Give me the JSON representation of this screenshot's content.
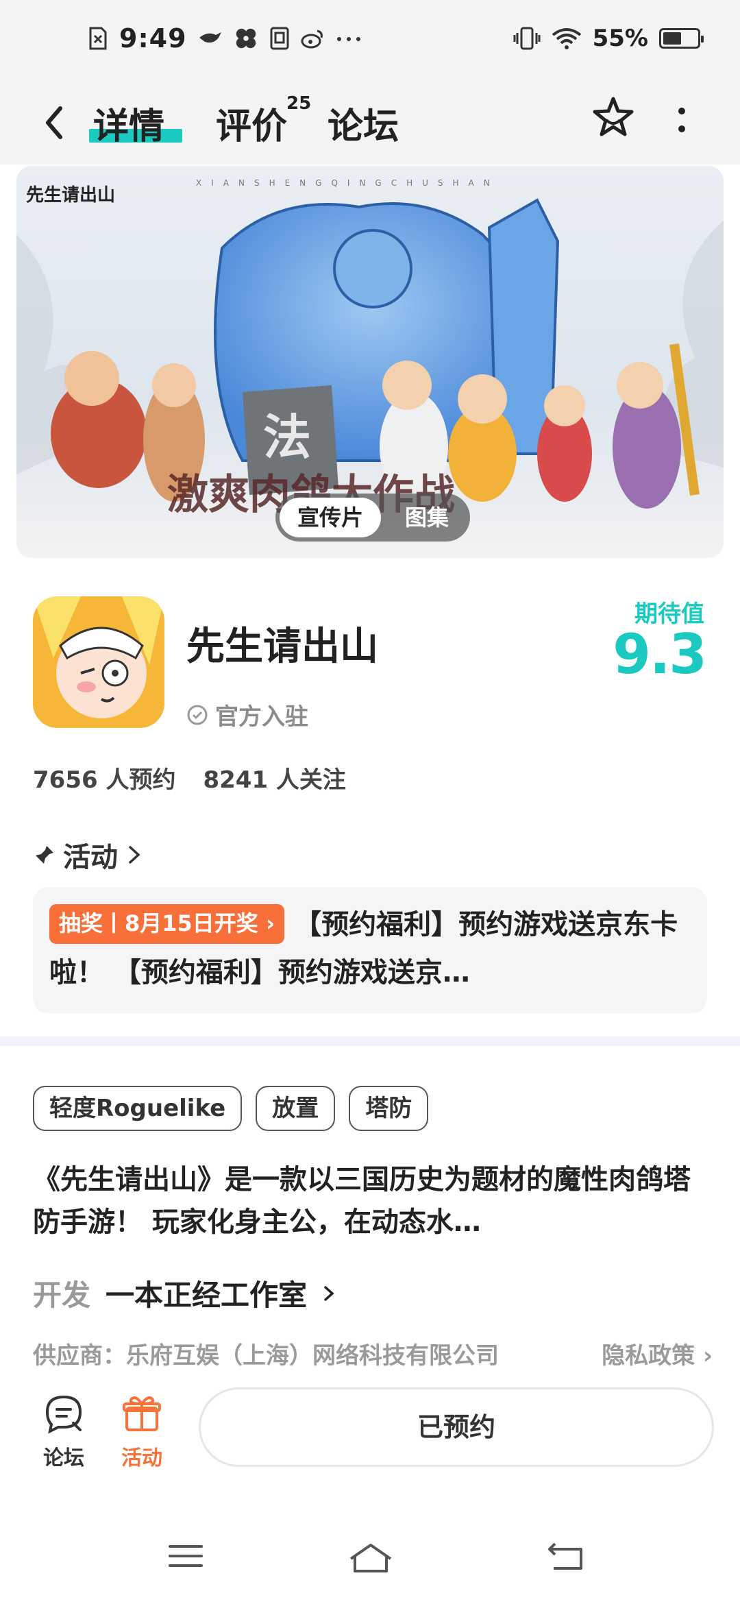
{
  "status_bar": {
    "time": "9:49",
    "battery": "55%",
    "battery_level": 0.55,
    "icons": [
      "sim-off-icon",
      "bird-icon",
      "pinwheel-icon",
      "notes-icon",
      "weibo-icon",
      "more-dots-icon",
      "vibrate-icon",
      "wifi-icon",
      "battery-icon"
    ]
  },
  "nav": {
    "tabs": [
      {
        "label": "详情",
        "active": true
      },
      {
        "label": "评价",
        "badge": "25"
      },
      {
        "label": "论坛"
      }
    ]
  },
  "banner": {
    "logo_text": "先生请出山",
    "subtitle_en": "XIANSHENGQINGCHUSHAN",
    "switch": {
      "video": "宣传片",
      "gallery": "图集"
    }
  },
  "game": {
    "name": "先生请出山",
    "official": "官方入驻",
    "expect_label": "期待值",
    "expect_value": "9.3",
    "reservations": "7656 人预约",
    "followers": "8241 人关注"
  },
  "activity": {
    "title": "活动",
    "badge": "抽奖丨8月15日开奖",
    "text": "【预约福利】预约游戏送京东卡啦！ 【预约福利】预约游戏送京…"
  },
  "tags": [
    "轻度Roguelike",
    "放置",
    "塔防"
  ],
  "description": "《先生请出山》是一款以三国历史为题材的魔性肉鸽塔防手游！ 玩家化身主公，在动态水…",
  "developer": {
    "label": "开发",
    "value": "一本正经工作室"
  },
  "supplier": "供应商：乐府互娱（上海）网络科技有限公司",
  "privacy": "隐私政策",
  "bottom_bar": {
    "forum": "论坛",
    "activity": "活动",
    "reserve": "已预约"
  },
  "colors": {
    "accent": "#1ac9bf",
    "orange": "#f96f3a"
  }
}
